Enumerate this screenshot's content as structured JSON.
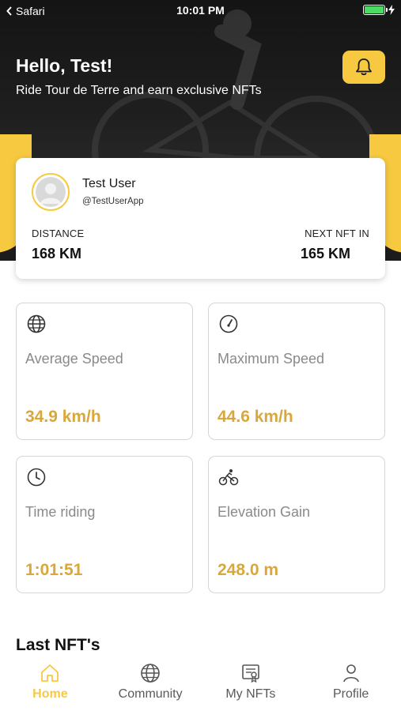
{
  "status_bar": {
    "back_app": "Safari",
    "time": "10:01 PM"
  },
  "header": {
    "greeting": "Hello, Test!",
    "subtitle": "Ride Tour de Terre and earn exclusive NFTs",
    "bell_icon": "bell-icon"
  },
  "profile": {
    "name": "Test User",
    "handle": "@TestUserApp",
    "distance_label": "DISTANCE",
    "distance_value": "168 KM",
    "next_nft_label": "NEXT NFT IN",
    "next_nft_value": "165 KM"
  },
  "stats": [
    {
      "icon": "globe-icon",
      "label": "Average Speed",
      "value": "34.9 km/h"
    },
    {
      "icon": "speedometer-icon",
      "label": "Maximum Speed",
      "value": "44.6 km/h"
    },
    {
      "icon": "clock-icon",
      "label": "Time riding",
      "value": "1:01:51"
    },
    {
      "icon": "cyclist-icon",
      "label": "Elevation Gain",
      "value": "248.0 m"
    }
  ],
  "section": {
    "title": "Last NFT's"
  },
  "tabs": [
    {
      "label": "Home",
      "icon": "home-icon",
      "active": true
    },
    {
      "label": "Community",
      "icon": "globe-icon",
      "active": false
    },
    {
      "label": "My NFTs",
      "icon": "certificate-icon",
      "active": false
    },
    {
      "label": "Profile",
      "icon": "person-icon",
      "active": false
    }
  ],
  "colors": {
    "accent": "#f6c941",
    "value_text": "#d9a73a",
    "hero_bg": "#1b1b1b"
  }
}
